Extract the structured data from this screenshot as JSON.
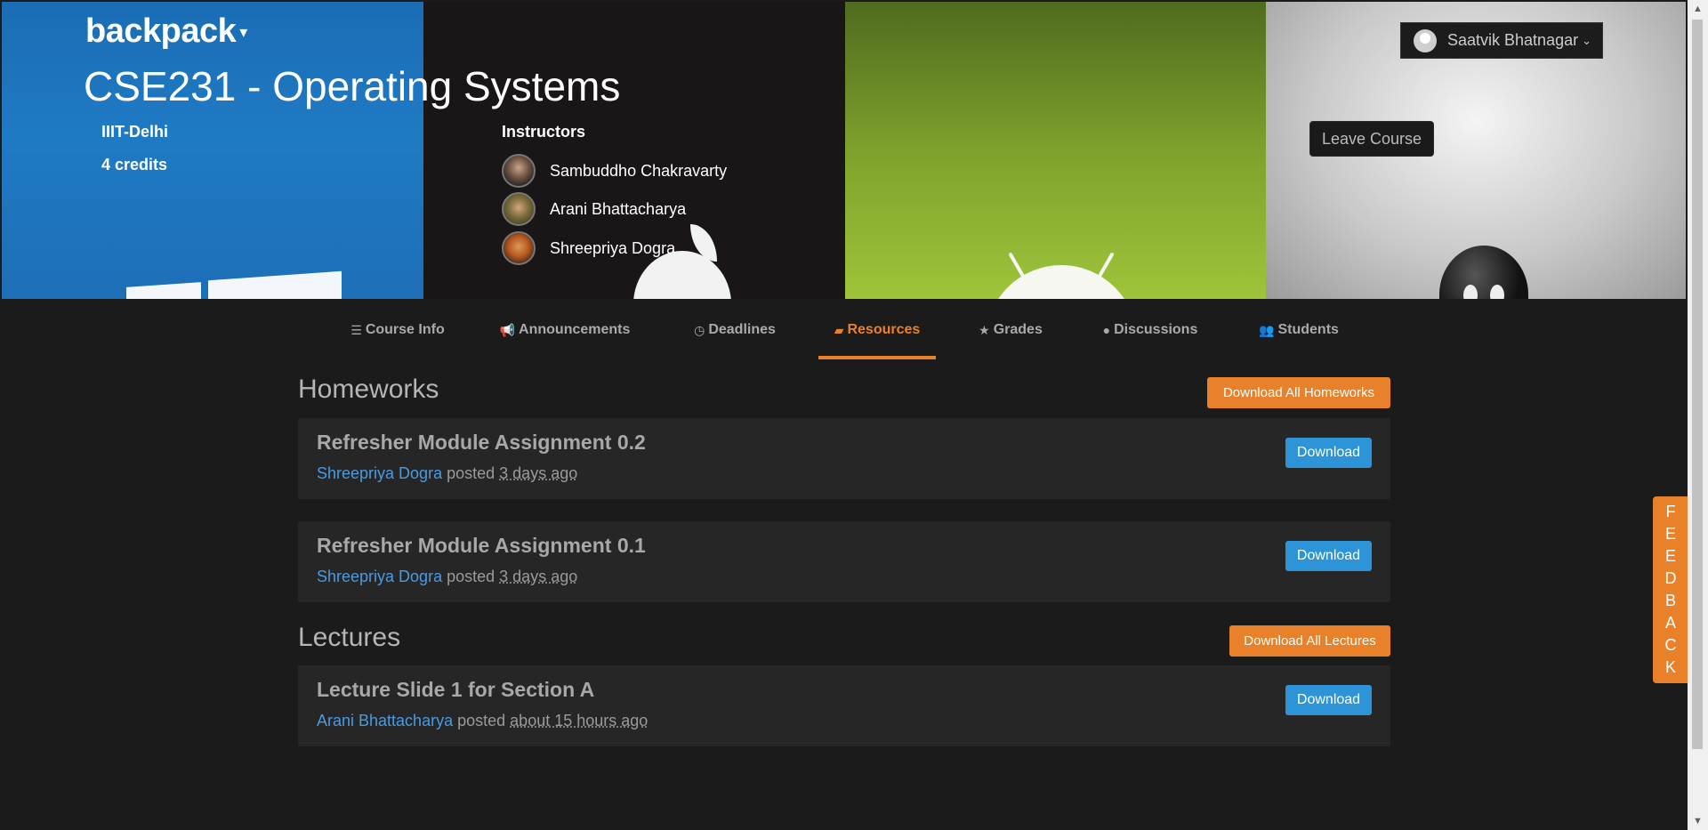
{
  "brand": {
    "name": "backpack",
    "caret": "▾"
  },
  "course": {
    "title": "CSE231 - Operating Systems",
    "institute": "IIIT-Delhi",
    "credits": "4 credits",
    "instructors_heading": "Instructors",
    "instructors": [
      {
        "name": "Sambuddho Chakravarty"
      },
      {
        "name": "Arani Bhattacharya"
      },
      {
        "name": "Shreepriya Dogra"
      }
    ]
  },
  "user": {
    "name": "Saatvik Bhatnagar",
    "caret": "⌄"
  },
  "leave_button": "Leave Course",
  "tabs": [
    {
      "label": "Course Info",
      "icon": "☰"
    },
    {
      "label": "Announcements",
      "icon": "📢"
    },
    {
      "label": "Deadlines",
      "icon": "◷"
    },
    {
      "label": "Resources",
      "icon": "▰"
    },
    {
      "label": "Grades",
      "icon": "★"
    },
    {
      "label": "Discussions",
      "icon": "●"
    },
    {
      "label": "Students",
      "icon": "👥"
    }
  ],
  "active_tab": "Resources",
  "homeworks": {
    "heading": "Homeworks",
    "download_all": "Download All Homeworks",
    "items": [
      {
        "title": "Refresher Module Assignment 0.2",
        "author": "Shreepriya Dogra",
        "verb": "posted",
        "time": "3 days ago",
        "button": "Download"
      },
      {
        "title": "Refresher Module Assignment 0.1",
        "author": "Shreepriya Dogra",
        "verb": "posted",
        "time": "3 days ago",
        "button": "Download"
      }
    ]
  },
  "lectures": {
    "heading": "Lectures",
    "download_all": "Download All Lectures",
    "items": [
      {
        "title": "Lecture Slide 1 for Section A",
        "author": "Arani Bhattacharya",
        "verb": "posted",
        "time": "about 15 hours ago",
        "button": "Download"
      }
    ]
  },
  "feedback": [
    "F",
    "E",
    "E",
    "D",
    "B",
    "A",
    "C",
    "K"
  ],
  "colors": {
    "accent": "#e8812a",
    "link": "#4a9be0",
    "download": "#2e94d8",
    "background": "#1b1b1b"
  }
}
